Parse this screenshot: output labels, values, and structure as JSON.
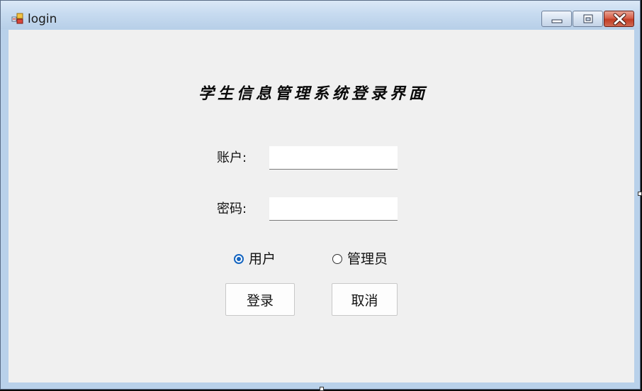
{
  "window": {
    "title": "login",
    "icon": "app-icon",
    "controls": {
      "minimize": "minimize-icon",
      "maximize": "maximize-icon",
      "close": "close-icon"
    }
  },
  "form": {
    "heading": "学生信息管理系统登录界面",
    "account_label": "账户:",
    "account_value": "",
    "password_label": "密码:",
    "password_value": "",
    "roles": [
      {
        "label": "用户",
        "checked": true
      },
      {
        "label": "管理员",
        "checked": false
      }
    ],
    "login_button": "登录",
    "cancel_button": "取消"
  },
  "colors": {
    "accent": "#1565c0",
    "client_background": "#f0f0f0",
    "close_button": "#c23c24"
  }
}
